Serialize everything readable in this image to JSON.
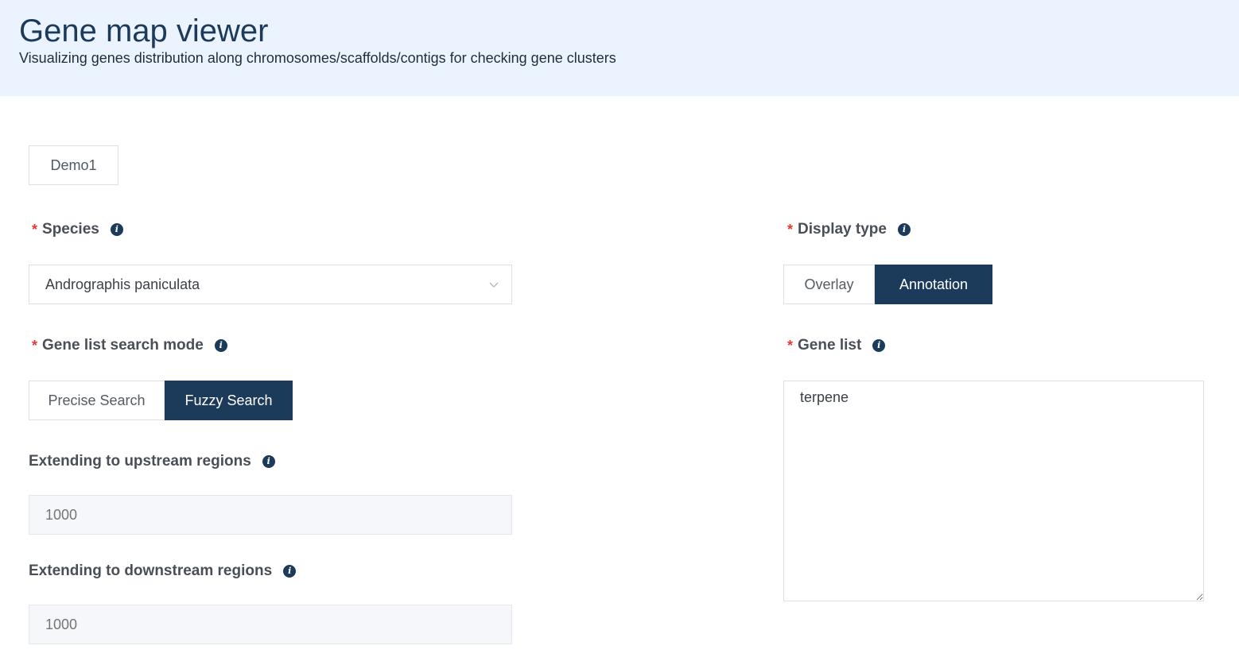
{
  "header": {
    "title": "Gene map viewer",
    "subtitle": "Visualizing genes distribution along chromosomes/scaffolds/contigs for checking gene clusters"
  },
  "demo": {
    "label": "Demo1"
  },
  "species": {
    "required_mark": "*",
    "label": "Species",
    "value": "Andrographis paniculata",
    "icon": "info-icon"
  },
  "search_mode": {
    "required_mark": "*",
    "label": "Gene list search mode",
    "options": [
      "Precise Search",
      "Fuzzy Search"
    ],
    "selected": "Fuzzy Search"
  },
  "upstream": {
    "label": "Extending to upstream regions",
    "placeholder": "1000"
  },
  "downstream": {
    "label": "Extending to downstream regions",
    "placeholder": "1000"
  },
  "display_type": {
    "required_mark": "*",
    "label": "Display type",
    "options": [
      "Overlay",
      "Annotation"
    ],
    "selected": "Annotation"
  },
  "gene_list": {
    "required_mark": "*",
    "label": "Gene list",
    "value": "terpene"
  },
  "colors": {
    "accent": "#1c3a5a",
    "header_bg": "#ebf3fe",
    "required": "#e53935"
  }
}
